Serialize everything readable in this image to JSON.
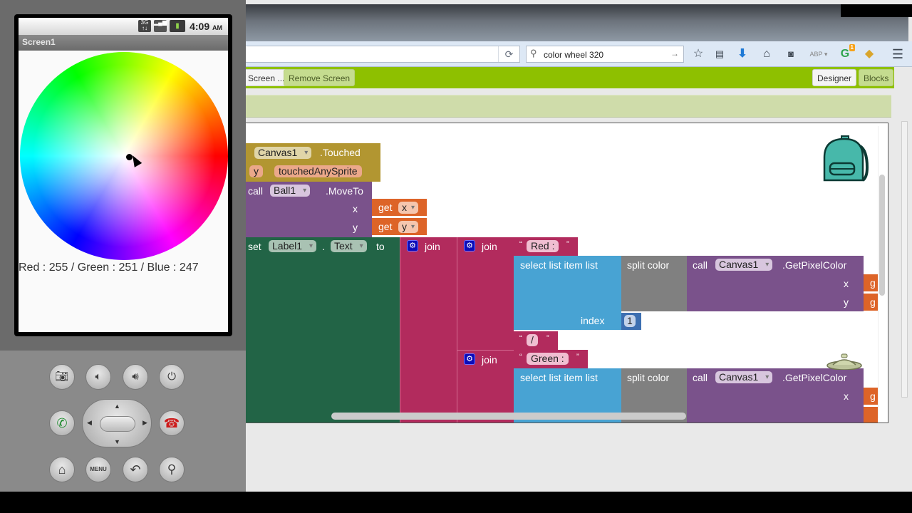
{
  "emulator": {
    "status_time": "4:09",
    "status_ampm": "AM",
    "status_icons": [
      "3g-icon",
      "signal-icon",
      "battery-icon"
    ],
    "app_title": "Screen1",
    "rgb_label": "Red : 255 / Green : 251 / Blue : 247",
    "buttons": {
      "row1": [
        "camera",
        "volume-down",
        "volume-up",
        "power"
      ],
      "row2": [
        "call",
        "dpad",
        "end-call"
      ],
      "row3": [
        "home",
        "MENU",
        "back",
        "search"
      ]
    }
  },
  "browser": {
    "search_query": "color wheel 320",
    "grammarly_badge": "1",
    "abp_label": "ABP"
  },
  "app_inventor": {
    "toolbar": {
      "add_screen": "Screen ...",
      "remove_screen": "Remove Screen",
      "designer": "Designer",
      "blocks": "Blocks"
    }
  },
  "blocks": {
    "event": {
      "component": "Canvas1",
      "event": ".Touched",
      "param_y": "y",
      "param_sprite": "touchedAnySprite"
    },
    "moveto": {
      "call": "call",
      "component": "Ball1",
      "method": ".MoveTo",
      "x_label": "x",
      "y_label": "y"
    },
    "get_x": {
      "get": "get",
      "var": "x"
    },
    "get_y": {
      "get": "get",
      "var": "y"
    },
    "set_label": {
      "set": "set",
      "component": "Label1",
      "dot": ".",
      "property": "Text",
      "to": "to"
    },
    "join_label": "join",
    "text_red": "Red :",
    "text_slash": "/",
    "text_green": "Green :",
    "select_list": "select list item  list",
    "index_label": "index",
    "index_value": "1",
    "split_color": "split color",
    "getpixel": {
      "call": "call",
      "component": "Canvas1",
      "method": ".GetPixelColor",
      "x_label": "x",
      "y_label": "y"
    },
    "get_partial": "g",
    "quote_open": "“",
    "quote_close": "”"
  }
}
